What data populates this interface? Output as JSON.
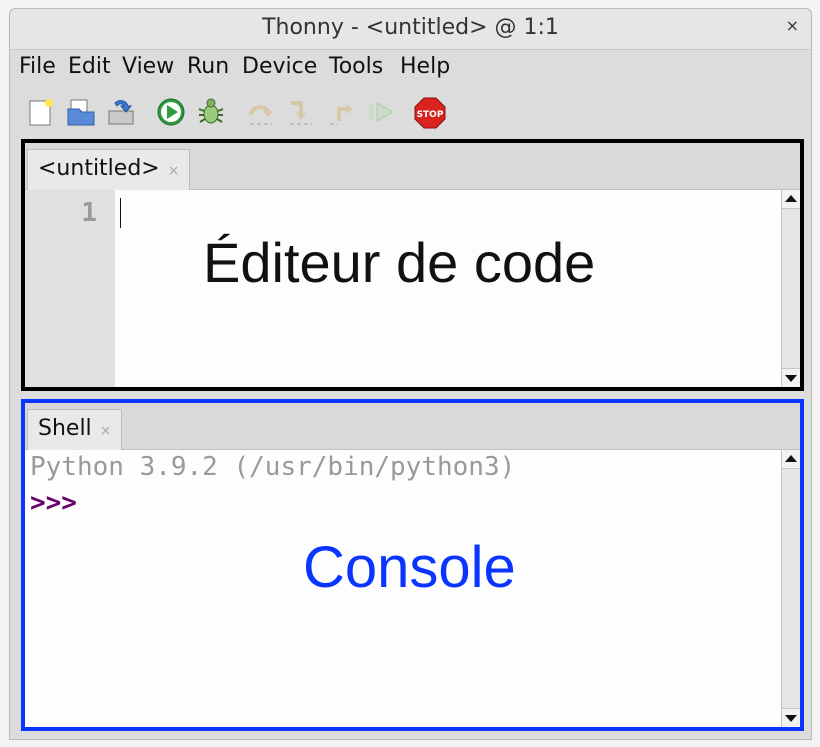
{
  "window": {
    "title": "Thonny  -  <untitled>  @  1:1",
    "close_glyph": "×"
  },
  "menu": {
    "items": [
      "File",
      "Edit",
      "View",
      "Run",
      "Device",
      "Tools",
      "Help"
    ]
  },
  "toolbar": {
    "icons": [
      "new-file-icon",
      "open-file-icon",
      "save-file-icon",
      "run-icon",
      "debug-icon",
      "step-over-icon",
      "step-into-icon",
      "step-out-icon",
      "resume-icon",
      "stop-icon"
    ],
    "stop_label": "STOP"
  },
  "editor": {
    "tab_label": "<untitled>",
    "tab_close": "×",
    "line_number": "1",
    "overlay_label": "Éditeur de code",
    "border_color": "#000000"
  },
  "shell": {
    "tab_label": "Shell",
    "tab_close": "×",
    "banner": "Python 3.9.2 (/usr/bin/python3)",
    "prompt": ">>>",
    "overlay_label": "Console",
    "border_color": "#0a35ff",
    "prompt_color": "#6b006b"
  }
}
